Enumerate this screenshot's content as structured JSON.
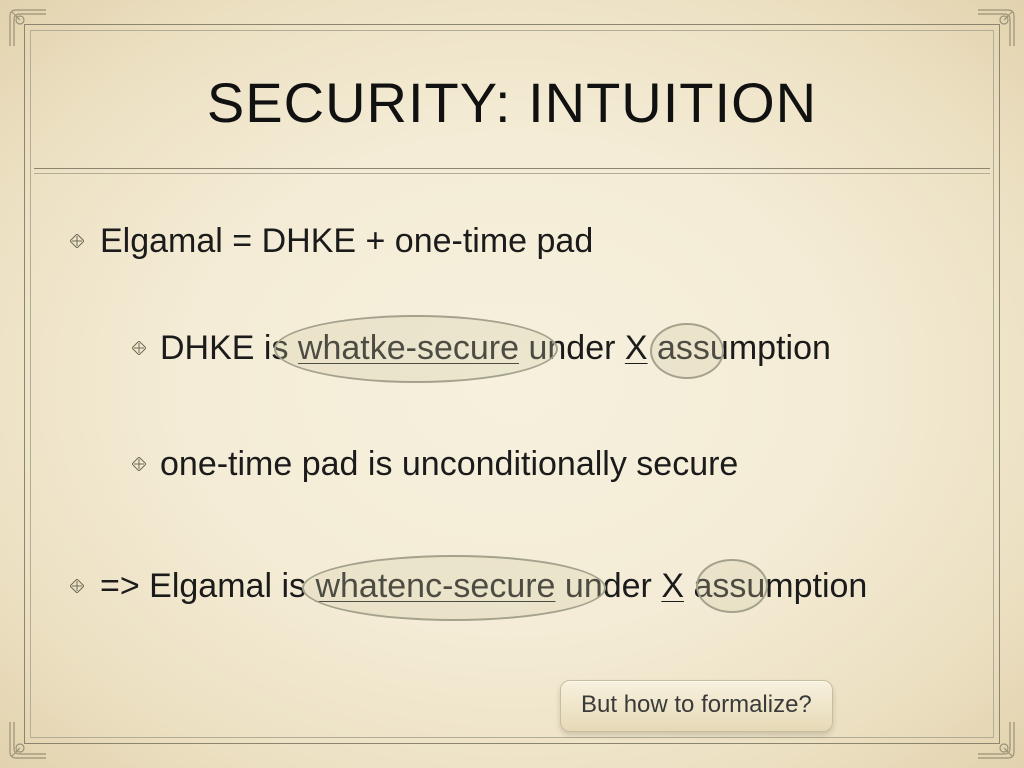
{
  "title": "SECURITY: INTUITION",
  "bullets": {
    "b1": "Elgamal = DHKE + one-time pad",
    "b2_pre": "DHKE is ",
    "b2_u1": "whatke-secure",
    "b2_mid": " under ",
    "b2_u2": "X",
    "b2_post": " assumption",
    "b3": "one-time pad is unconditionally secure",
    "b4_pre": "=> Elgamal is ",
    "b4_u1": "whatenc-secure",
    "b4_mid": " under ",
    "b4_u2": "X",
    "b4_post": " assumption"
  },
  "callout": "But how to formalize?"
}
